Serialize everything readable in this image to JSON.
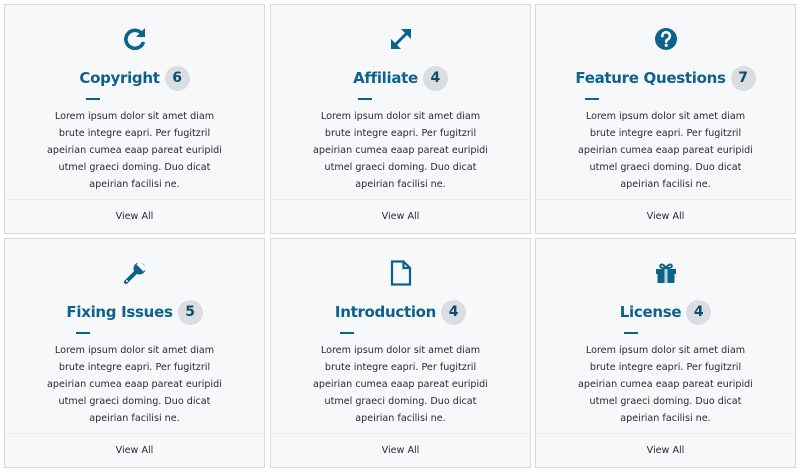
{
  "colors": {
    "accent": "#0c6289",
    "badge_bg": "#dcdde0",
    "card_bg": "#f7f8fa",
    "border": "#d8dadd"
  },
  "cards": [
    {
      "icon": "refresh-icon",
      "title": "Copyright",
      "count": "6",
      "description": "Lorem ipsum dolor sit amet diam brute integre eapri. Per fugitzril apeirian cumea eaap pareat euripidi utmel graeci doming. Duo dicat apeirian facilisi ne.",
      "link": "View All"
    },
    {
      "icon": "expand-arrows-icon",
      "title": "Affiliate",
      "count": "4",
      "description": "Lorem ipsum dolor sit amet diam brute integre eapri. Per fugitzril apeirian cumea eaap pareat euripidi utmel graeci doming. Duo dicat apeirian facilisi ne.",
      "link": "View All"
    },
    {
      "icon": "question-circle-icon",
      "title": "Feature Questions",
      "count": "7",
      "description": "Lorem ipsum dolor sit amet diam brute integre eapri. Per fugitzril apeirian cumea eaap pareat euripidi utmel graeci doming. Duo dicat apeirian facilisi ne.",
      "link": "View All"
    },
    {
      "icon": "wrench-icon",
      "title": "Fixing Issues",
      "count": "5",
      "description": "Lorem ipsum dolor sit amet diam brute integre eapri. Per fugitzril apeirian cumea eaap pareat euripidi utmel graeci doming. Duo dicat apeirian facilisi ne.",
      "link": "View All"
    },
    {
      "icon": "document-icon",
      "title": "Introduction",
      "count": "4",
      "description": "Lorem ipsum dolor sit amet diam brute integre eapri. Per fugitzril apeirian cumea eaap pareat euripidi utmel graeci doming. Duo dicat apeirian facilisi ne.",
      "link": "View All"
    },
    {
      "icon": "gift-icon",
      "title": "License",
      "count": "4",
      "description": "Lorem ipsum dolor sit amet diam brute integre eapri. Per fugitzril apeirian cumea eaap pareat euripidi utmel graeci doming. Duo dicat apeirian facilisi ne.",
      "link": "View All"
    }
  ]
}
